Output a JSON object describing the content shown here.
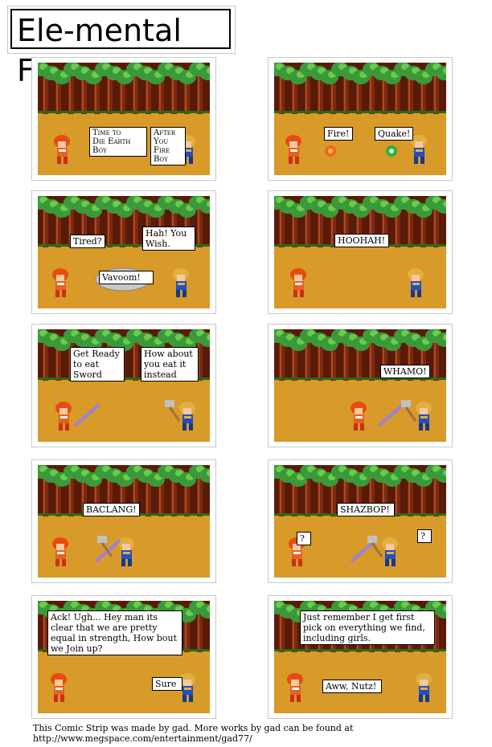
{
  "title": "Ele-mental Fury",
  "panels": [
    {
      "texts": [
        "Time to\nDie Earth\nBoy",
        "After\nYou\nFire\nBoy"
      ]
    },
    {
      "texts": [
        "Fire!",
        "Quake!"
      ]
    },
    {
      "texts": [
        "Tired?",
        "Hah!  You\nWish.",
        "Vavoom!"
      ]
    },
    {
      "texts": [
        "HOOHAH!"
      ]
    },
    {
      "texts": [
        "Get Ready\nto eat\nSword",
        "How about\nyou eat it\ninstead"
      ]
    },
    {
      "texts": [
        "WHAMO!"
      ]
    },
    {
      "texts": [
        "BACLANG!"
      ]
    },
    {
      "texts": [
        "SHAZBOP!",
        "?",
        "?"
      ]
    },
    {
      "texts": [
        "Ack! Ugh...  Hey man its\nclear that we are pretty\nequal in strength, How bout\nwe Join up?",
        "Sure"
      ]
    },
    {
      "texts": [
        "Just remember I get first\npick on everything we find,\nincluding girls.",
        "Aww, Nutz!"
      ]
    }
  ],
  "credit": "This Comic Strip was made by gad.  More works by gad can be found at\nhttp://www.megspace.com/entertainment/gad77/",
  "colors": {
    "sky": "#f8f8f8",
    "trees": "#3a9a3a",
    "trunk": "#7a2a10",
    "ground": "#d89a28"
  }
}
